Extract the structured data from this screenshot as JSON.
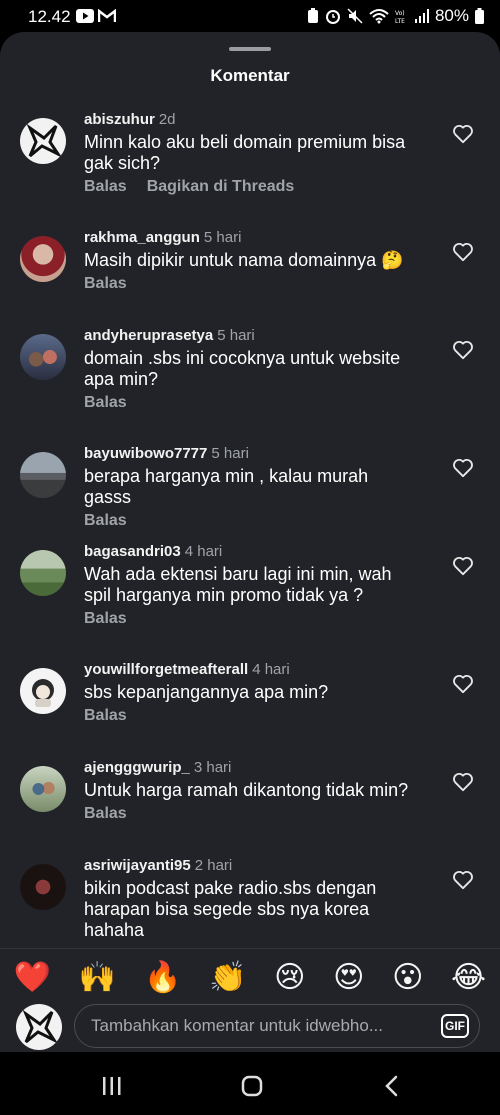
{
  "status": {
    "time": "12.42",
    "battery": "80%"
  },
  "header": {
    "title": "Komentar"
  },
  "comments": [
    {
      "user": "abiszuhur",
      "time": "2d",
      "text": "Minn kalo aku beli domain premium bisa gak sich?",
      "actions": [
        "Balas",
        "Bagikan di Threads"
      ]
    },
    {
      "user": "rakhma_anggun",
      "time": "5 hari",
      "text": "Masih dipikir untuk nama domainnya 🤔",
      "actions": [
        "Balas"
      ]
    },
    {
      "user": "andyheruprasetya",
      "time": "5 hari",
      "text": "domain .sbs ini cocoknya untuk website apa min?",
      "actions": [
        "Balas"
      ]
    },
    {
      "user": "bayuwibowo7777",
      "time": "5 hari",
      "text": "berapa harganya min , kalau murah gasss",
      "actions": [
        "Balas"
      ]
    },
    {
      "user": "bagasandri03",
      "time": "4 hari",
      "text": "Wah ada ektensi baru lagi ini min, wah spil harganya min promo tidak ya ?",
      "actions": [
        "Balas"
      ]
    },
    {
      "user": "youwillforgetmeafterall",
      "time": "4 hari",
      "text": "sbs kepanjangannya apa min?",
      "actions": [
        "Balas"
      ]
    },
    {
      "user": "ajengggwurip_",
      "time": "3 hari",
      "text": "Untuk harga ramah dikantong tidak min?",
      "actions": [
        "Balas"
      ]
    },
    {
      "user": "asriwijayanti95",
      "time": "2 hari",
      "text": "bikin podcast pake radio.sbs dengan harapan bisa segede sbs nya korea hahaha",
      "actions": []
    }
  ],
  "reactions": [
    "❤️",
    "🙌",
    "🔥",
    "👏",
    "😢",
    "😍",
    "😮",
    "😂"
  ],
  "composer": {
    "placeholder": "Tambahkan komentar untuk idwebho...",
    "gif_label": "GIF"
  }
}
